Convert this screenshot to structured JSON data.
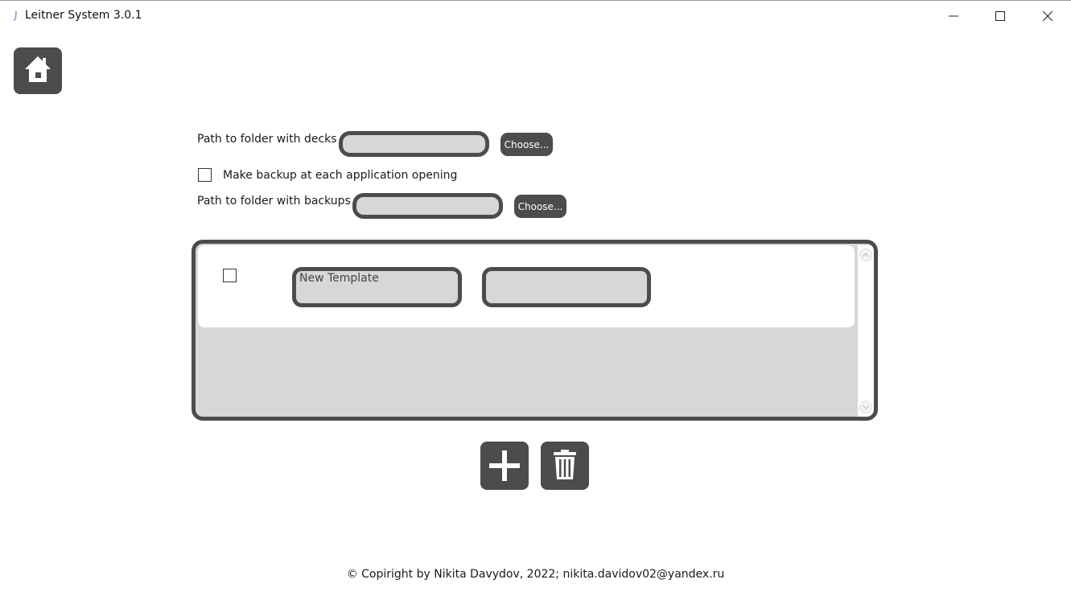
{
  "window": {
    "title": "Leitner System 3.0.1",
    "icon": "app-icon",
    "controls": [
      "minimize-icon",
      "maximize-icon",
      "close-icon"
    ]
  },
  "home_button": {
    "icon": "home-icon"
  },
  "settings": {
    "decks_path_label": "Path to folder with decks",
    "decks_path_value": "",
    "decks_choose_label": "Choose...",
    "backup_checkbox_label": "Make backup at each application opening",
    "backup_checked": false,
    "backups_path_label": "Path to folder with backups",
    "backups_path_value": "",
    "backups_choose_label": "Choose..."
  },
  "templates": [
    {
      "checked": false,
      "name": "New Template",
      "value": ""
    }
  ],
  "actions": {
    "add_icon": "plus-icon",
    "delete_icon": "trash-icon"
  },
  "footer": {
    "text": "© Copiright by Nikita Davydov, 2022; nikita.davidov02@yandex.ru"
  },
  "colors": {
    "control_dark": "#4d4b4b",
    "field_fill": "#d7d7d7",
    "background": "#ffffff"
  }
}
